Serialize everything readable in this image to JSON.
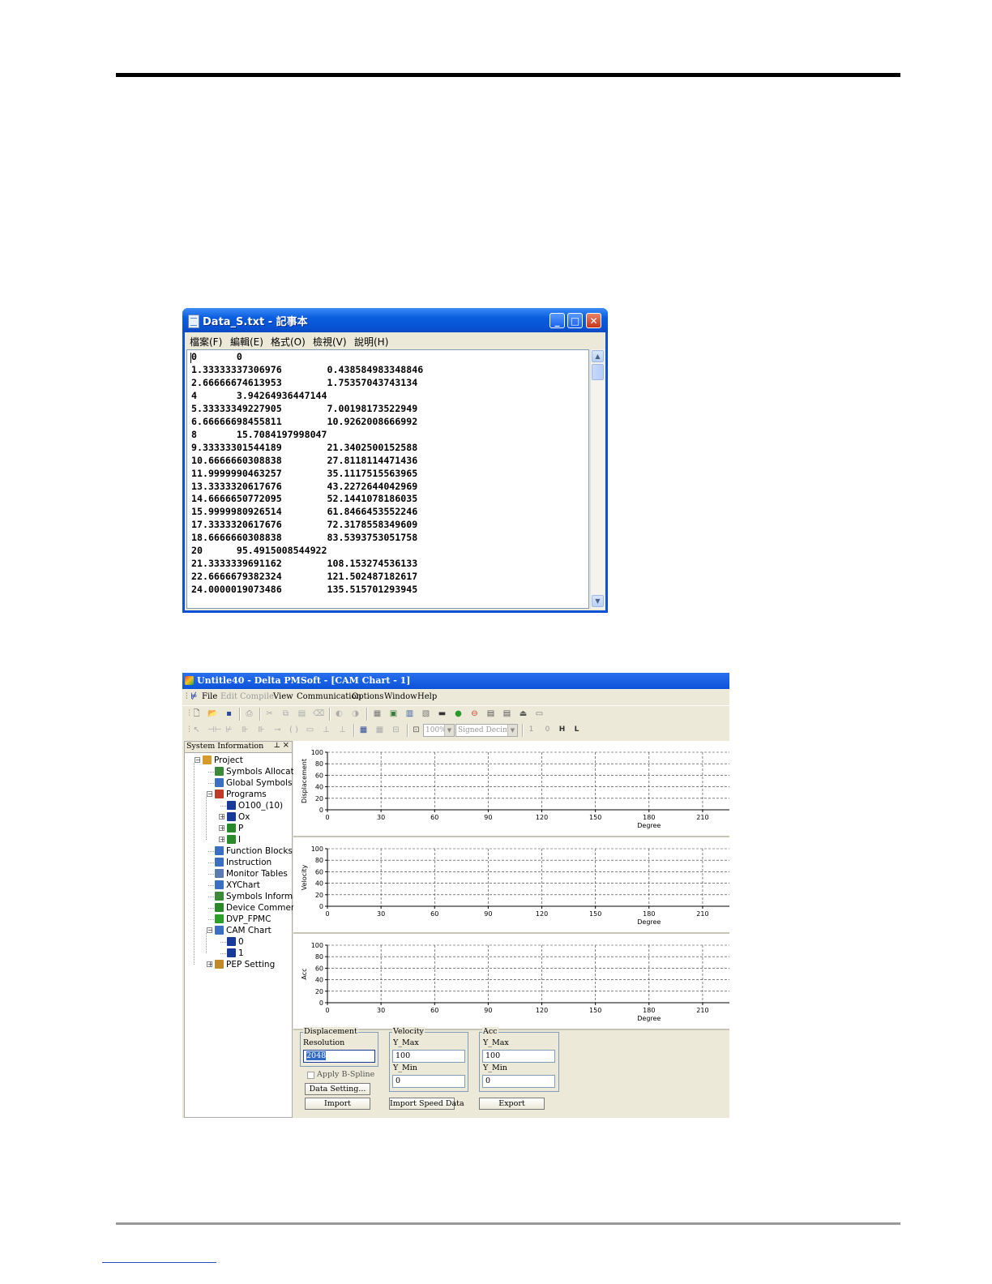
{
  "notepad": {
    "title": "Data_S.txt - 記事本",
    "menu": [
      "檔案(F)",
      "編輯(E)",
      "格式(O)",
      "檢視(V)",
      "說明(H)"
    ],
    "lines": [
      "0\t0",
      "1.33333337306976\t0.438584983348846",
      "2.66666674613953\t1.75357043743134",
      "4\t3.94264936447144",
      "5.33333349227905\t7.00198173522949",
      "6.66666698455811\t10.9262008666992",
      "8\t15.7084197998047",
      "9.33333301544189\t21.3402500152588",
      "10.6666660308838\t27.8118114471436",
      "11.9999990463257\t35.1117515563965",
      "13.3333320617676\t43.2272644042969",
      "14.6666650772095\t52.1441078186035",
      "15.9999980926514\t61.8466453552246",
      "17.3333320617676\t72.3178558349609",
      "18.6666660308838\t83.5393753051758",
      "20\t95.4915008544922",
      "21.3333339691162\t108.153274536133",
      "22.6666679382324\t121.502487182617",
      "24.0000019073486\t135.515701293945"
    ]
  },
  "pmsoft": {
    "title": "Untitle40 - Delta PMSoft - [CAM Chart - 1]",
    "menu": {
      "file": "File",
      "edit": "Edit",
      "compile": "Compile",
      "view": "View",
      "communication": "Communication",
      "options": "Options",
      "window": "Window",
      "help": "Help"
    },
    "toolbar": {
      "zoom": "100%",
      "format": "Signed Decimal",
      "btn_1": "1",
      "btn_0": "0",
      "btn_h": "H",
      "btn_l": "L"
    },
    "system_info": {
      "title": "System Information",
      "pin": "ᵽ",
      "close": "×",
      "tree": [
        {
          "label": "Project",
          "icon": "project-icon",
          "color": "#d89a2a"
        },
        {
          "label": "Symbols Allocation",
          "icon": "symbols-allocation-icon",
          "color": "#3a8a3a"
        },
        {
          "label": "Global Symbols",
          "icon": "global-symbols-icon",
          "color": "#3b6fc0"
        },
        {
          "label": "Programs",
          "icon": "programs-icon",
          "color": "#c03a2a"
        },
        {
          "label": "O100_(10)",
          "icon": "arrow-down-icon",
          "color": "#1a3a9a"
        },
        {
          "label": "Ox",
          "icon": "refresh-icon",
          "color": "#1a3a9a"
        },
        {
          "label": "P",
          "icon": "program-p-icon",
          "color": "#2a8a2a"
        },
        {
          "label": "I",
          "icon": "program-i-icon",
          "color": "#2a8a2a"
        },
        {
          "label": "Function Blocks",
          "icon": "function-blocks-icon",
          "color": "#3b6fc0"
        },
        {
          "label": "Instruction",
          "icon": "instruction-icon",
          "color": "#3b6fc0"
        },
        {
          "label": "Monitor Tables",
          "icon": "monitor-tables-icon",
          "color": "#5a7ab0"
        },
        {
          "label": "XYChart",
          "icon": "xychart-icon",
          "color": "#3b6fc0"
        },
        {
          "label": "Symbols Information",
          "icon": "symbols-info-icon",
          "color": "#3a8a3a"
        },
        {
          "label": "Device Comments",
          "icon": "device-comments-icon",
          "color": "#2a8a2a"
        },
        {
          "label": "DVP_FPMC",
          "icon": "dvp-fpmc-icon",
          "color": "#2aa02a"
        },
        {
          "label": "CAM Chart",
          "icon": "cam-chart-icon",
          "color": "#3b6fc0"
        },
        {
          "label": "0",
          "icon": "cam-chart-item-icon",
          "color": "#1a3a9a"
        },
        {
          "label": "1",
          "icon": "cam-chart-item-icon",
          "color": "#1a3a9a"
        },
        {
          "label": "PEP Setting",
          "icon": "pep-setting-icon",
          "color": "#c08a2a"
        }
      ]
    },
    "charts": {
      "y_ticks": [
        "0",
        "20",
        "40",
        "60",
        "80",
        "100"
      ],
      "x_ticks": [
        "0",
        "30",
        "60",
        "90",
        "120",
        "150",
        "180",
        "210"
      ],
      "x_label": "Degree",
      "y_labels": [
        "Displacement",
        "Velocity",
        "Acc"
      ]
    },
    "controls": {
      "displacement": {
        "legend": "Displacement",
        "resolution_label": "Resolution",
        "resolution_value": "2048"
      },
      "velocity": {
        "legend": "Velocity",
        "ymax_label": "Y_Max",
        "ymax_value": "100",
        "ymin_label": "Y_Min",
        "ymin_value": "0"
      },
      "acc": {
        "legend": "Acc",
        "ymax_label": "Y_Max",
        "ymax_value": "100",
        "ymin_label": "Y_Min",
        "ymin_value": "0"
      },
      "apply_bspline": "Apply B-Spline",
      "data_setting": "Data Setting...",
      "import": "Import",
      "import_speed": "Import Speed Data",
      "export": "Export"
    }
  },
  "chart_data": [
    {
      "type": "line",
      "ylabel": "Displacement",
      "xlabel": "Degree",
      "x_ticks": [
        0,
        30,
        60,
        90,
        120,
        150,
        180,
        210
      ],
      "y_ticks": [
        0,
        20,
        40,
        60,
        80,
        100
      ],
      "ylim": [
        0,
        100
      ],
      "series": [],
      "grid": true
    },
    {
      "type": "line",
      "ylabel": "Velocity",
      "xlabel": "Degree",
      "x_ticks": [
        0,
        30,
        60,
        90,
        120,
        150,
        180,
        210
      ],
      "y_ticks": [
        0,
        20,
        40,
        60,
        80,
        100
      ],
      "ylim": [
        0,
        100
      ],
      "series": [],
      "grid": true
    },
    {
      "type": "line",
      "ylabel": "Acc",
      "xlabel": "Degree",
      "x_ticks": [
        0,
        30,
        60,
        90,
        120,
        150,
        180,
        210
      ],
      "y_ticks": [
        0,
        20,
        40,
        60,
        80,
        100
      ],
      "ylim": [
        0,
        100
      ],
      "series": [],
      "grid": true
    }
  ]
}
